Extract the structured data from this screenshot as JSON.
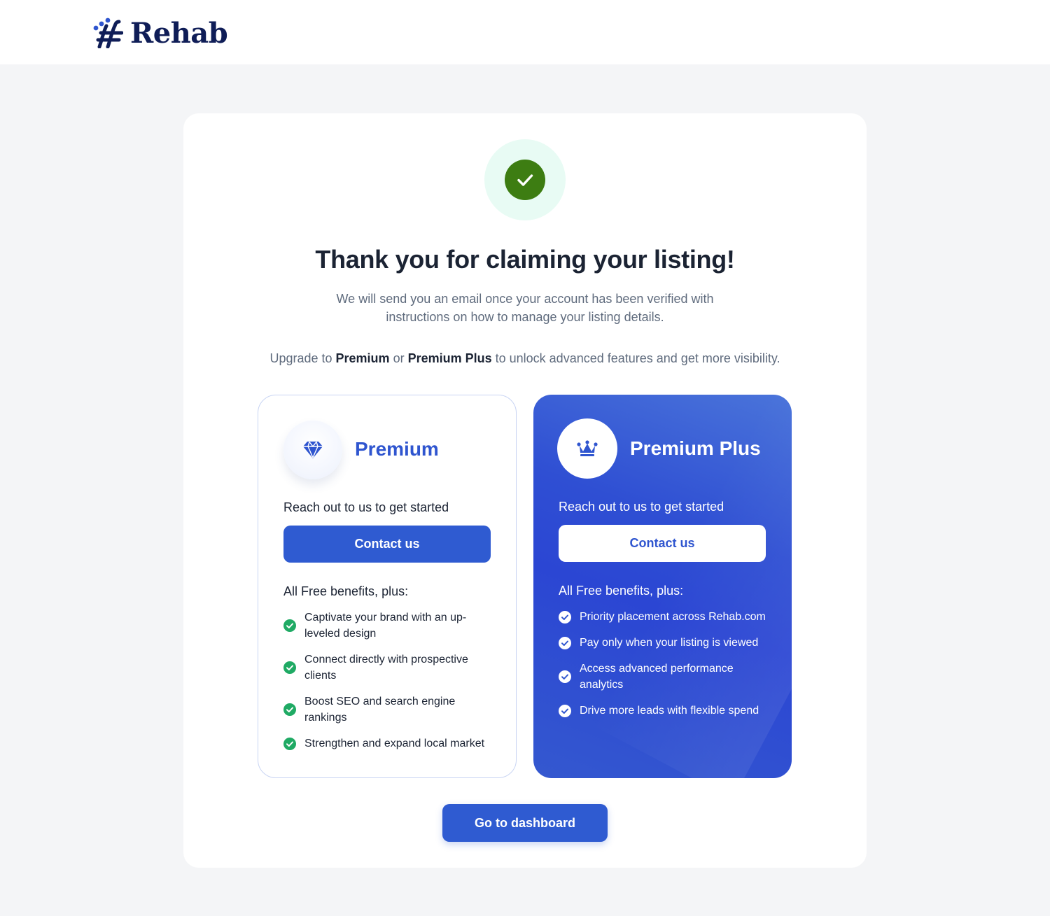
{
  "brand": {
    "name": "Rehab"
  },
  "header": {
    "title": "Thank you for claiming your listing!",
    "subtitle": "We will send you an email once your account has been verified with instructions on how to manage your listing details.",
    "upgrade": {
      "prefix": "Upgrade to ",
      "tier1": "Premium",
      "middle": " or ",
      "tier2": "Premium Plus",
      "suffix": " to unlock advanced features and get more visibility."
    }
  },
  "cards": {
    "premium": {
      "name": "Premium",
      "icon": "diamond-icon",
      "cta_text": "Reach out to us to get started",
      "button": "Contact us",
      "benefits_title": "All Free benefits, plus:",
      "benefits": [
        "Captivate your brand with an up-leveled design",
        "Connect directly with prospective clients",
        "Boost SEO and search engine rankings",
        "Strengthen and expand local market"
      ]
    },
    "premium_plus": {
      "name": "Premium Plus",
      "icon": "crown-icon",
      "cta_text": "Reach out to us to get started",
      "button": "Contact us",
      "benefits_title": "All Free benefits, plus:",
      "benefits": [
        "Priority placement across Rehab.com",
        "Pay only when your listing is viewed",
        "Access advanced performance analytics",
        "Drive more leads with flexible spend"
      ]
    }
  },
  "footer": {
    "dashboard_button": "Go to dashboard"
  },
  "colors": {
    "brand_navy": "#0f1d57",
    "primary_blue": "#2f5bd1",
    "success_green": "#3d7d12",
    "success_halo": "#e8fbf4",
    "benefit_check": "#1faa64"
  }
}
